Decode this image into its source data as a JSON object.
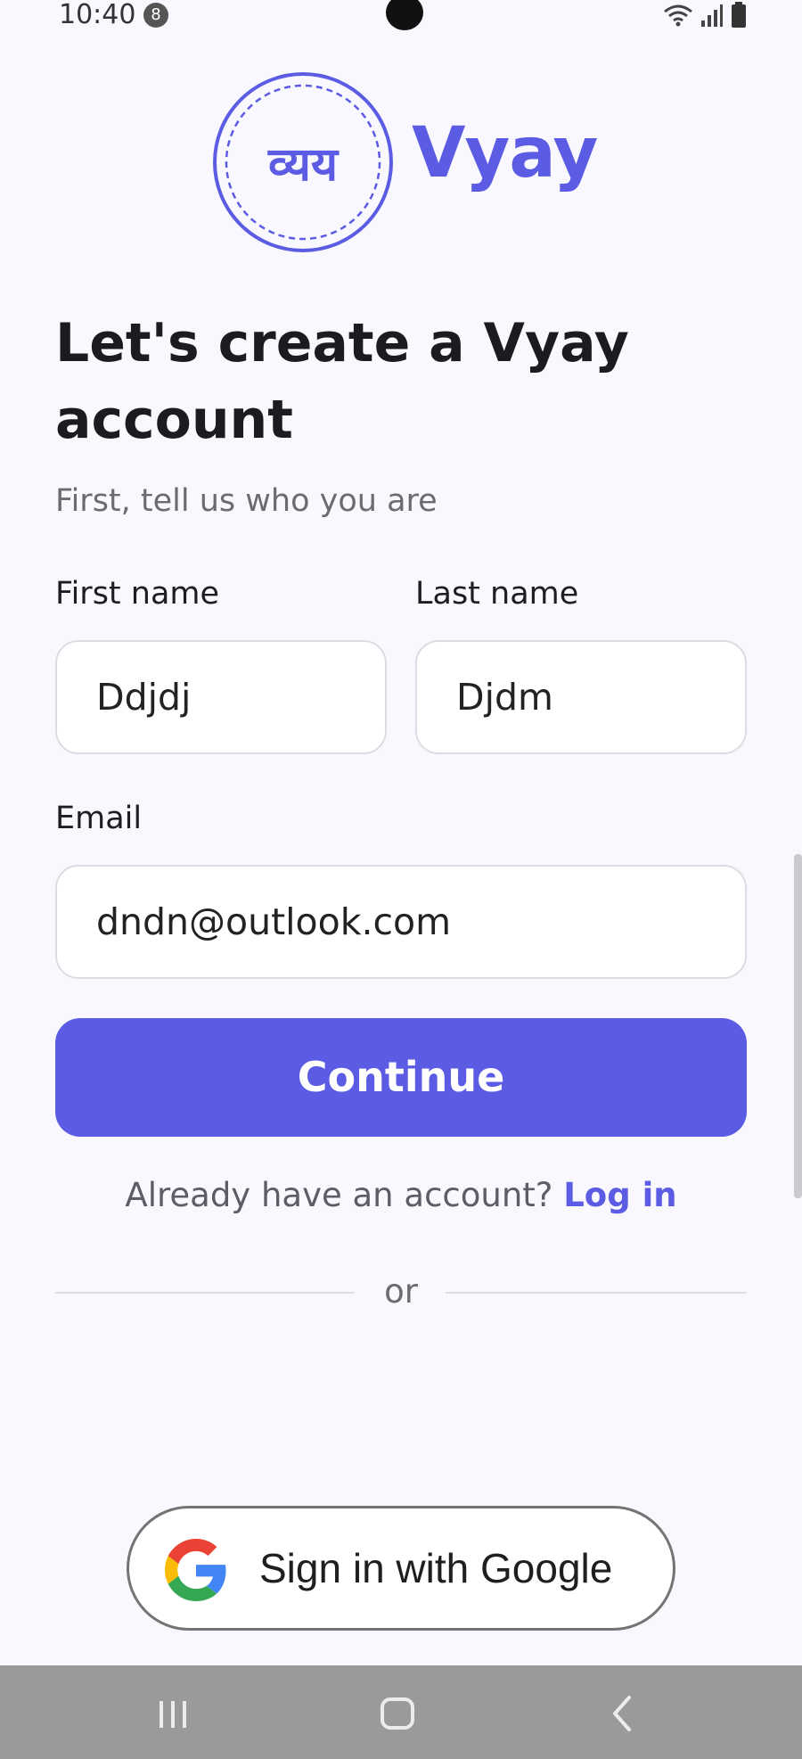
{
  "status_bar": {
    "time": "10:40",
    "notification_count": "8"
  },
  "brand": {
    "logo_text": "व्यय",
    "name": "Vyay"
  },
  "headline": "Let's create a Vyay account",
  "subtitle": "First, tell us who you are",
  "form": {
    "first_name": {
      "label": "First name",
      "value": "Ddjdj"
    },
    "last_name": {
      "label": "Last name",
      "value": "Djdm"
    },
    "email": {
      "label": "Email",
      "value": "dndn@outlook.com"
    },
    "continue_label": "Continue"
  },
  "login": {
    "prompt": "Already have an account?",
    "link": "Log in"
  },
  "divider_text": "or",
  "google": {
    "label": "Sign in with Google"
  },
  "colors": {
    "accent": "#5b5be3",
    "background": "#f8f8fe",
    "nav_bar": "#9a9a9a"
  }
}
